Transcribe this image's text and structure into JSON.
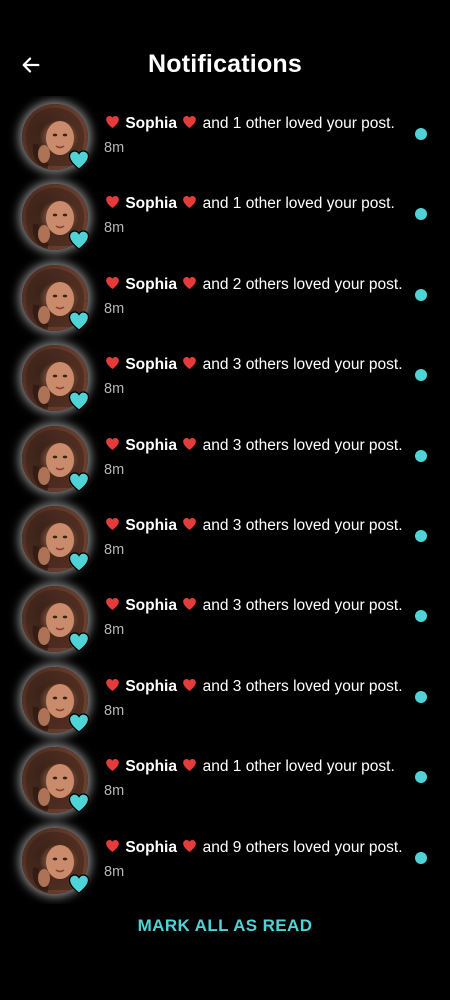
{
  "header": {
    "title": "Notifications",
    "back_icon": "arrow-left-icon"
  },
  "colors": {
    "background": "#000000",
    "accent": "#4fd3d6",
    "heart_red": "#e63b3b",
    "time_gray": "#b5b5b5"
  },
  "notifications": [
    {
      "name": "Sophia",
      "message": "and 1 other loved your post.",
      "time": "8m",
      "unread": true
    },
    {
      "name": "Sophia",
      "message": "and 1 other loved your post.",
      "time": "8m",
      "unread": true
    },
    {
      "name": "Sophia",
      "message": "and 2 others loved your post.",
      "time": "8m",
      "unread": true
    },
    {
      "name": "Sophia",
      "message": "and 3 others loved your post.",
      "time": "8m",
      "unread": true
    },
    {
      "name": "Sophia",
      "message": "and 3 others loved your post.",
      "time": "8m",
      "unread": true
    },
    {
      "name": "Sophia",
      "message": "and 3 others loved your post.",
      "time": "8m",
      "unread": true
    },
    {
      "name": "Sophia",
      "message": "and 3 others loved your post.",
      "time": "8m",
      "unread": true
    },
    {
      "name": "Sophia",
      "message": "and 3 others loved your post.",
      "time": "8m",
      "unread": true
    },
    {
      "name": "Sophia",
      "message": "and 1 other loved your post.",
      "time": "8m",
      "unread": true
    },
    {
      "name": "Sophia",
      "message": "and 9 others loved your post.",
      "time": "8m",
      "unread": true
    }
  ],
  "footer": {
    "mark_all_label": "MARK ALL AS READ"
  }
}
